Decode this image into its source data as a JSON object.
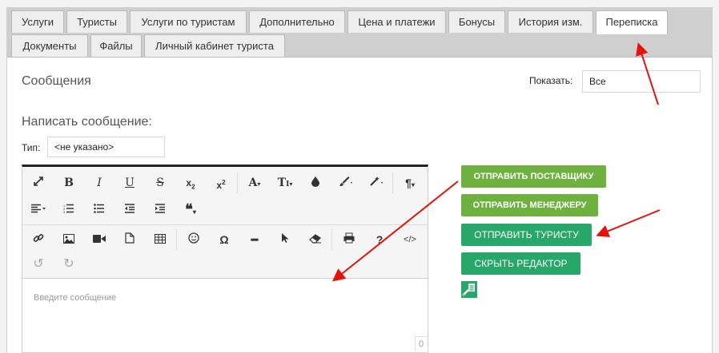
{
  "tabs_row1": [
    "Услуги",
    "Туристы",
    "Услуги по туристам",
    "Дополнительно",
    "Цена и платежи",
    "Бонусы",
    "История изм.",
    "Переписка"
  ],
  "tabs_row2": [
    "Документы",
    "Файлы",
    "Личный кабинет туриста"
  ],
  "active_tab": "Переписка",
  "messages_title": "Сообщения",
  "show_label": "Показать:",
  "show_value": "Все",
  "compose_title": "Написать сообщение:",
  "type_label": "Тип:",
  "type_value": "<не указано>",
  "editor": {
    "placeholder": "Введите сообщение",
    "char_count": "0",
    "toolbar_icons": [
      "fullscreen-icon",
      "bold-icon",
      "italic-icon",
      "underline-icon",
      "strikethrough-icon",
      "subscript-icon",
      "superscript-icon",
      "font-family-icon",
      "font-size-icon",
      "color-icon",
      "paint-brush-icon",
      "magic-wand-icon",
      "paragraph-icon",
      "align-icon",
      "ordered-list-icon",
      "unordered-list-icon",
      "outdent-icon",
      "indent-icon",
      "quote-icon",
      "link-icon",
      "image-icon",
      "video-icon",
      "file-icon",
      "table-icon",
      "emoticon-icon",
      "special-char-icon",
      "horizontal-line-icon",
      "select-all-icon",
      "clear-format-icon",
      "print-icon",
      "help-icon",
      "code-view-icon",
      "undo-icon",
      "redo-icon"
    ]
  },
  "buttons": {
    "send_supplier": "Отправить поставщику",
    "send_manager": "Отправить менеджеру",
    "send_tourist": "Отправить туристу",
    "hide_editor": "Скрыть редактор"
  },
  "colors": {
    "light_green": "#6eb13e",
    "dark_green": "#27a769",
    "arrow_red": "#e3120b"
  }
}
